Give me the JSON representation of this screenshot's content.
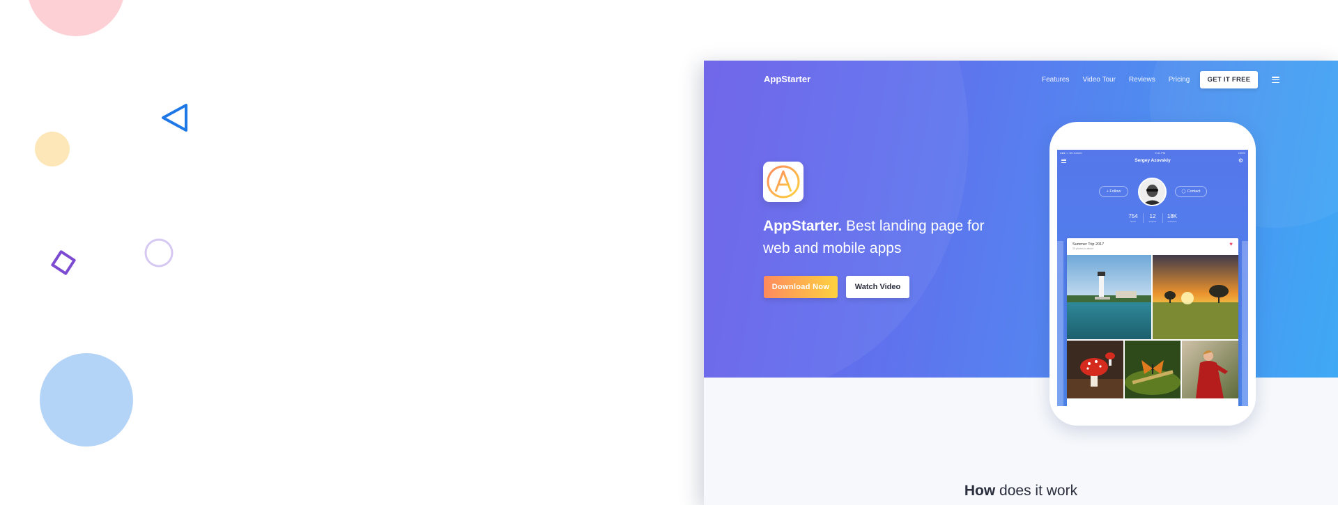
{
  "colors": {
    "hero_start": "#6a5fe8",
    "hero_end": "#3fa9f5",
    "download_start": "#fd8a5e",
    "download_end": "#fdd23f",
    "section_bg": "#f6f8fb"
  },
  "decorations": [
    "pink-circle-icon",
    "blue-triangle-icon",
    "yellow-circle-icon",
    "purple-diamond-icon",
    "lavender-ring-icon",
    "blue-circle-icon"
  ],
  "nav": {
    "logo": "AppStarter",
    "links": [
      "Features",
      "Video Tour",
      "Reviews",
      "Pricing"
    ],
    "cta": "GET IT FREE",
    "menu_icon": "hamburger-icon"
  },
  "hero": {
    "app_icon": "app-logo-icon",
    "headline_bold": "AppStarter.",
    "headline_rest": " Best landing page for web and mobile apps",
    "primary_button": "Download Now",
    "secondary_button": "Watch Video"
  },
  "phone": {
    "status_left": "●●●○○ 3G Carrier",
    "status_time": "9:41 PM",
    "status_right": "100%",
    "profile_name": "Sergey Azovskiy",
    "follow": "+ Follow",
    "contact": "Contact",
    "stats": [
      {
        "value": "754",
        "label": "Shots"
      },
      {
        "value": "12",
        "label": "Projects"
      },
      {
        "value": "18K",
        "label": "Followers"
      }
    ],
    "album_title": "Summer Trip 2017",
    "album_subtitle": "20 photos in album"
  },
  "section": {
    "title_bold": "How",
    "title_rest": " does it work"
  }
}
